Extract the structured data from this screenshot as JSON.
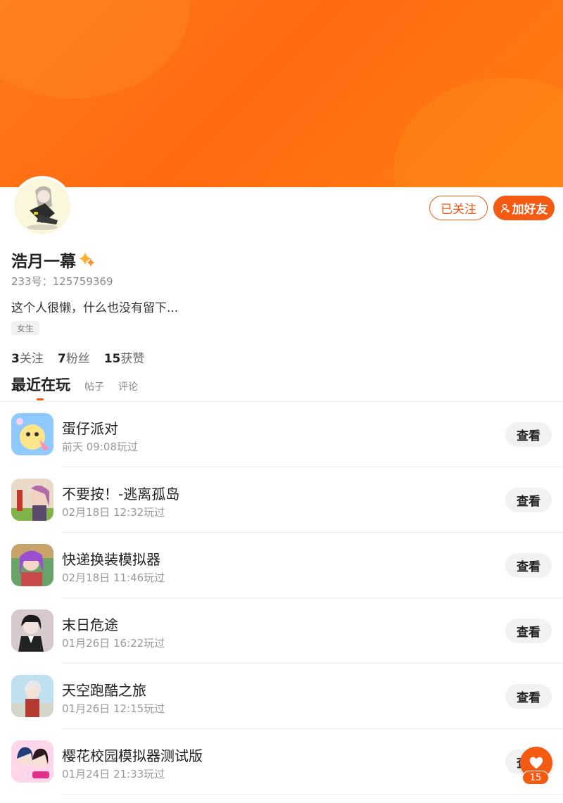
{
  "profile": {
    "username": "浩月一幕",
    "uid_text": "233号：125759369",
    "bio": "这个人很懒，什么也没有留下...",
    "gender_tag": "女生",
    "stats": {
      "following_count": "3",
      "following_label": "关注",
      "followers_count": "7",
      "followers_label": "粉丝",
      "likes_count": "15",
      "likes_label": "获赞"
    }
  },
  "actions": {
    "followed_label": "已关注",
    "add_friend_label": "加好友"
  },
  "tabs": [
    {
      "label": "最近在玩",
      "active": true
    },
    {
      "label": "帖子",
      "active": false
    },
    {
      "label": "评论",
      "active": false
    }
  ],
  "games": [
    {
      "title": "蛋仔派对",
      "time": "前天 09:08玩过",
      "button": "查看"
    },
    {
      "title": "不要按！-逃离孤岛",
      "time": "02月18日 12:32玩过",
      "button": "查看"
    },
    {
      "title": "快递换装模拟器",
      "time": "02月18日 11:46玩过",
      "button": "查看"
    },
    {
      "title": "末日危途",
      "time": "01月26日 16:22玩过",
      "button": "查看"
    },
    {
      "title": "天空跑酷之旅",
      "time": "01月26日 12:15玩过",
      "button": "查看"
    },
    {
      "title": "樱花校园模拟器测试版",
      "time": "01月24日 21:33玩过",
      "button": "查看"
    }
  ],
  "like_fab": {
    "count": "15"
  },
  "colors": {
    "accent": "#f55a12",
    "banner": "#ff6f14"
  }
}
